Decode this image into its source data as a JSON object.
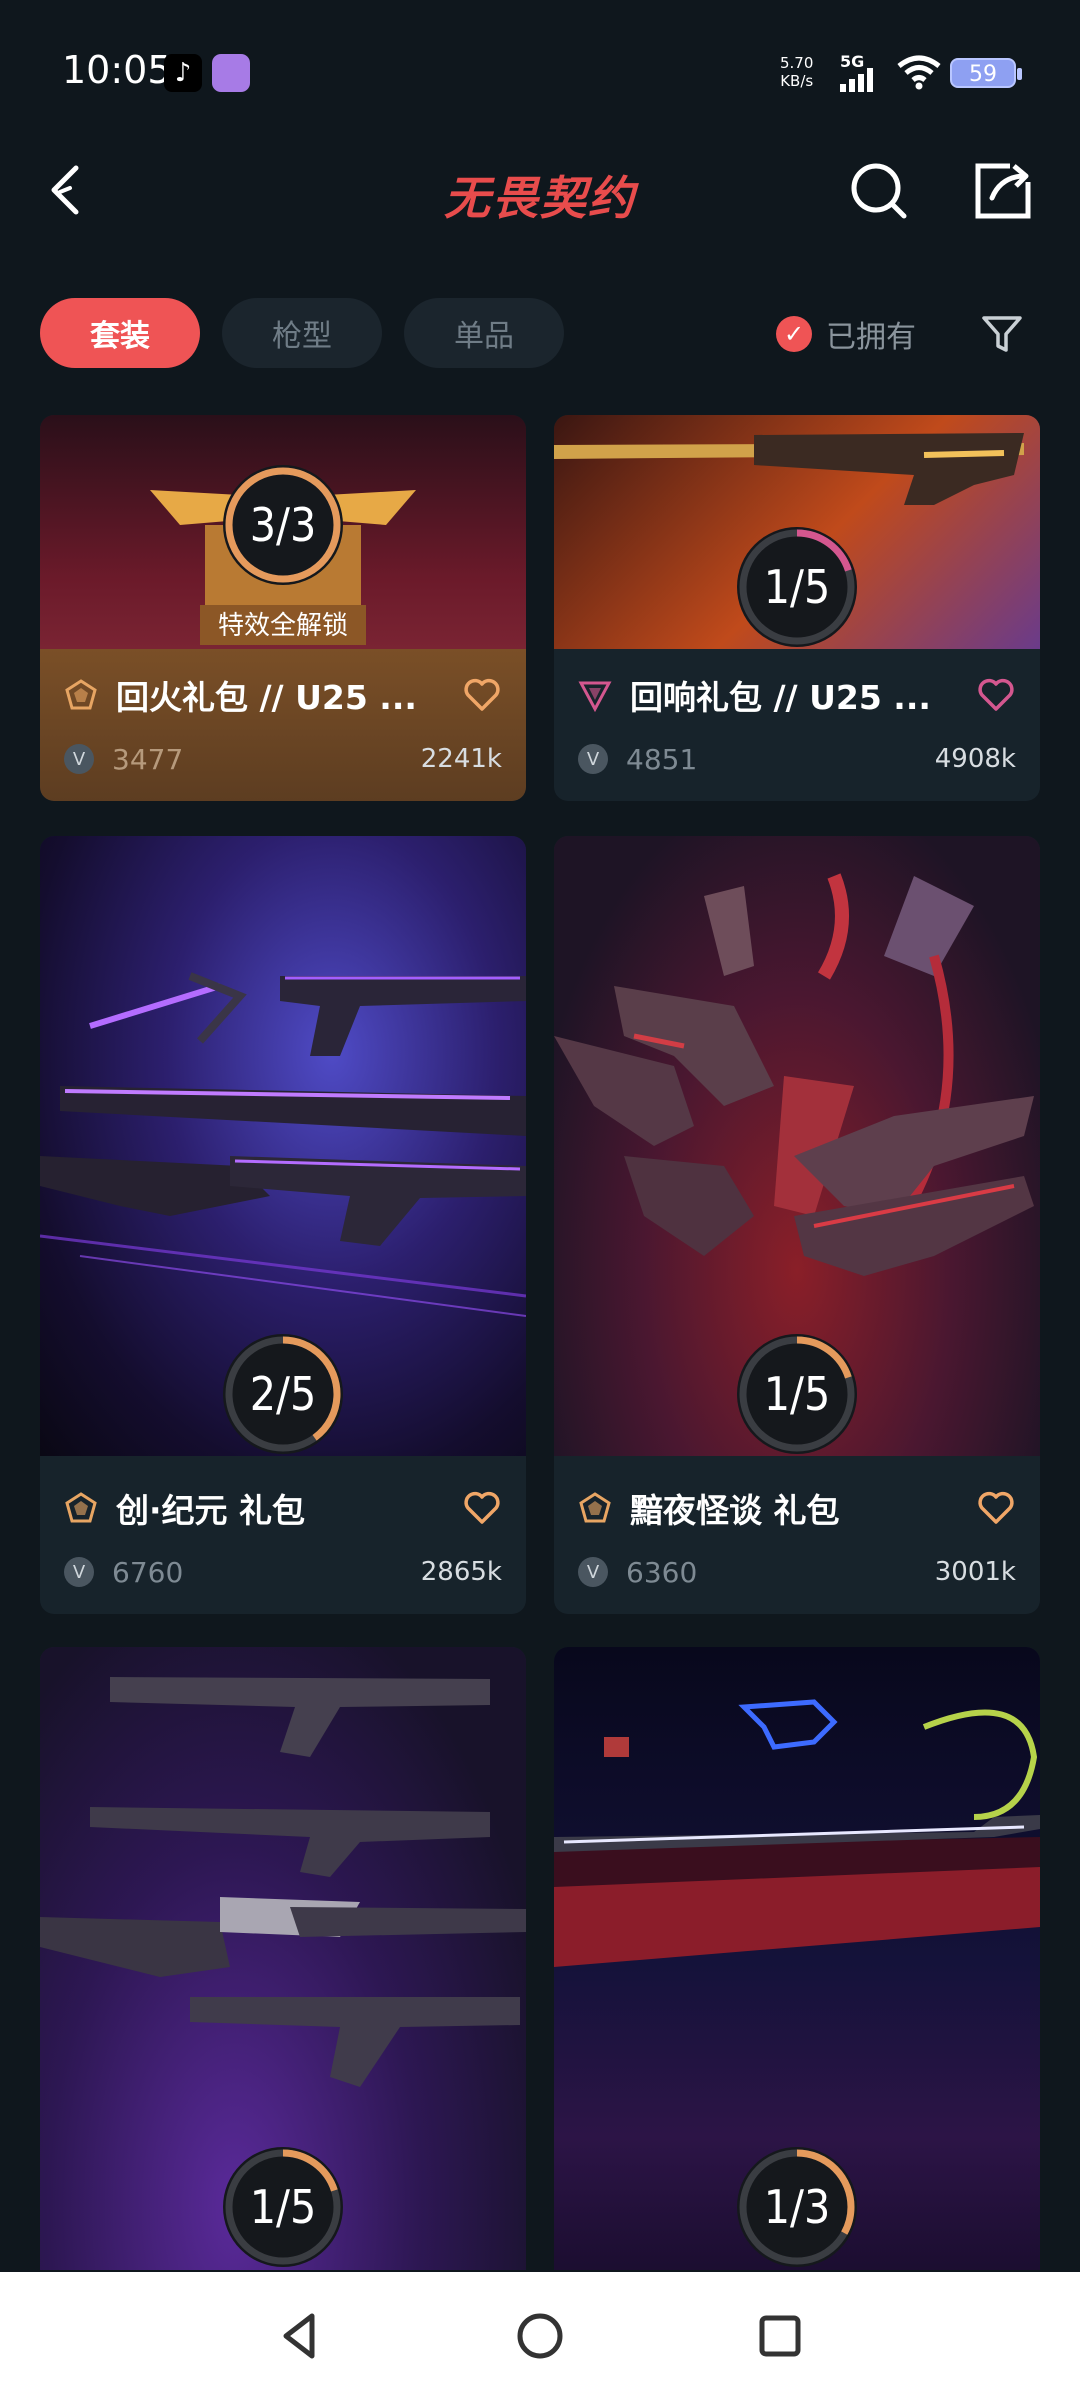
{
  "status": {
    "time": "10:05",
    "net_speed_value": "5.70",
    "net_speed_unit": "KB/s",
    "signal_label": "5G",
    "battery": "59"
  },
  "header": {
    "title": "无畏契约"
  },
  "tabs": [
    {
      "label": "套装",
      "active": true
    },
    {
      "label": "枪型",
      "active": false
    },
    {
      "label": "单品",
      "active": false
    }
  ],
  "owned_label": "已拥有",
  "cards": [
    {
      "name": "回火礼包 // U25 ...",
      "count": "3477",
      "likes": "2241k",
      "progress": "3/3",
      "progress_fraction": 1.0,
      "unlock_label": "特效全解锁"
    },
    {
      "name": "回响礼包 // U25 ...",
      "count": "4851",
      "likes": "4908k",
      "progress": "1/5",
      "progress_fraction": 0.2
    },
    {
      "name": "创·纪元 礼包",
      "count": "6760",
      "likes": "2865k",
      "progress": "2/5",
      "progress_fraction": 0.4
    },
    {
      "name": "黯夜怪谈 礼包",
      "count": "6360",
      "likes": "3001k",
      "progress": "1/5",
      "progress_fraction": 0.2
    },
    {
      "progress": "1/5",
      "progress_fraction": 0.2
    },
    {
      "progress": "1/3",
      "progress_fraction": 0.33
    }
  ],
  "colors": {
    "accent": "#ef5455",
    "ring_orange": "#e59a5c",
    "ring_pink": "#d4578f",
    "background": "#0f171d"
  }
}
